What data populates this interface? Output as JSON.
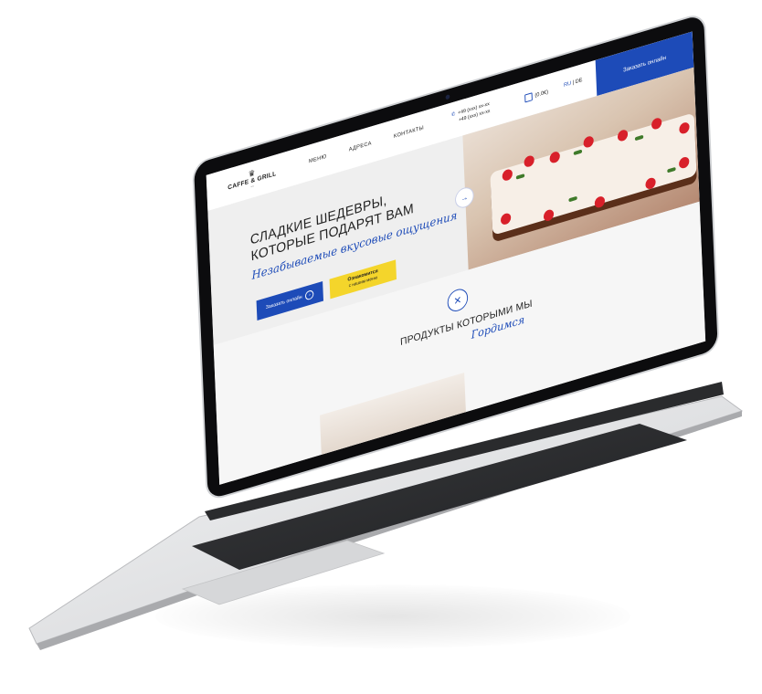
{
  "header": {
    "logo_name": "CAFFE & GRILL",
    "nav": [
      "МЕНЮ",
      "АДРЕСА",
      "КОНТАКТЫ"
    ],
    "phones": [
      "+49 (xxx) xx-xx",
      "+49 (xxx) xx-xx"
    ],
    "cart_value": "(0.0€)",
    "lang_active": "RU",
    "lang_sep": " | ",
    "lang_other": "DE",
    "order_button": "Заказать онлайн"
  },
  "hero": {
    "title_line1": "СЛАДКИЕ ШЕДЕВРЫ,",
    "title_line2": "КОТОРЫЕ ПОДАРЯТ ВАМ",
    "script": "Незабываемые вкусовые ощущения",
    "btn_primary": "Заказать онлайн",
    "btn_secondary_line1": "Ознакомится",
    "btn_secondary_line2": "с нашим меню",
    "arrow": "→"
  },
  "products": {
    "title": "ПРОДУКТЫ КОТОРЫМИ МЫ",
    "script": "Гордимся"
  },
  "colors": {
    "brand_blue": "#1d4bb8",
    "accent_yellow": "#f4d52b",
    "bezel": "#0c0c0e",
    "aluminium": "#e2e3e5"
  }
}
